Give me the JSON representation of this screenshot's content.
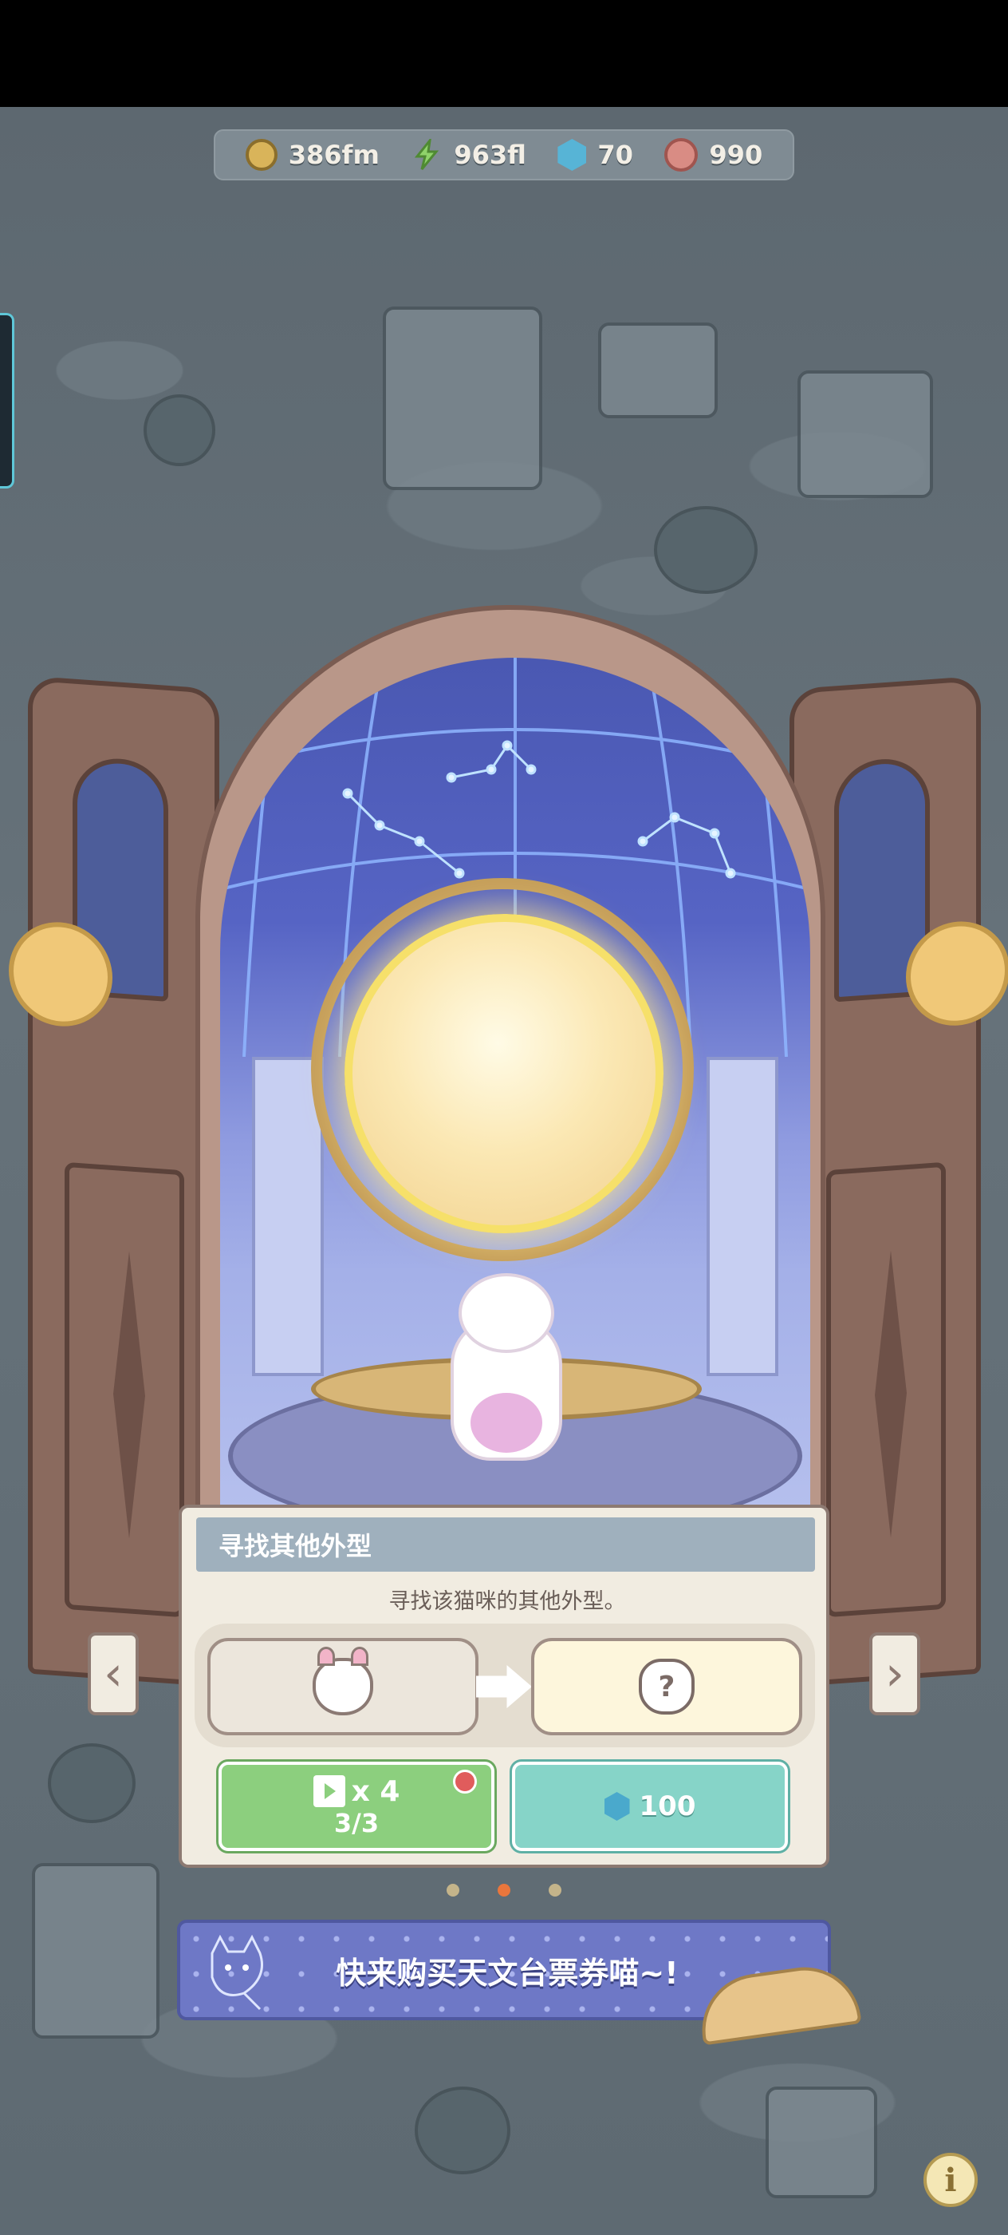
{
  "resources": {
    "coins": "386fm",
    "energy": "963fl",
    "gems": "70",
    "paws": "990"
  },
  "dialog": {
    "title": "寻找其他外型",
    "description": "寻找该猫咪的其他外型。",
    "unknown_symbol": "?",
    "ad_button": {
      "multiplier": "x 4",
      "remaining": "3/3"
    },
    "gem_button": {
      "cost": "100"
    }
  },
  "navigation": {
    "prev_symbol": "‹",
    "next_symbol": "›",
    "page_count": 3,
    "active_page": 2
  },
  "banner": {
    "text": "快来购买天文台票券喵~!"
  },
  "info_button": {
    "symbol": "i"
  },
  "colors": {
    "ad_button": "#8ccf7e",
    "gem_button": "#86d4c8",
    "banner": "#6e78c6",
    "active_dot": "#e9763c",
    "orb_glow": "#f6e06a"
  }
}
